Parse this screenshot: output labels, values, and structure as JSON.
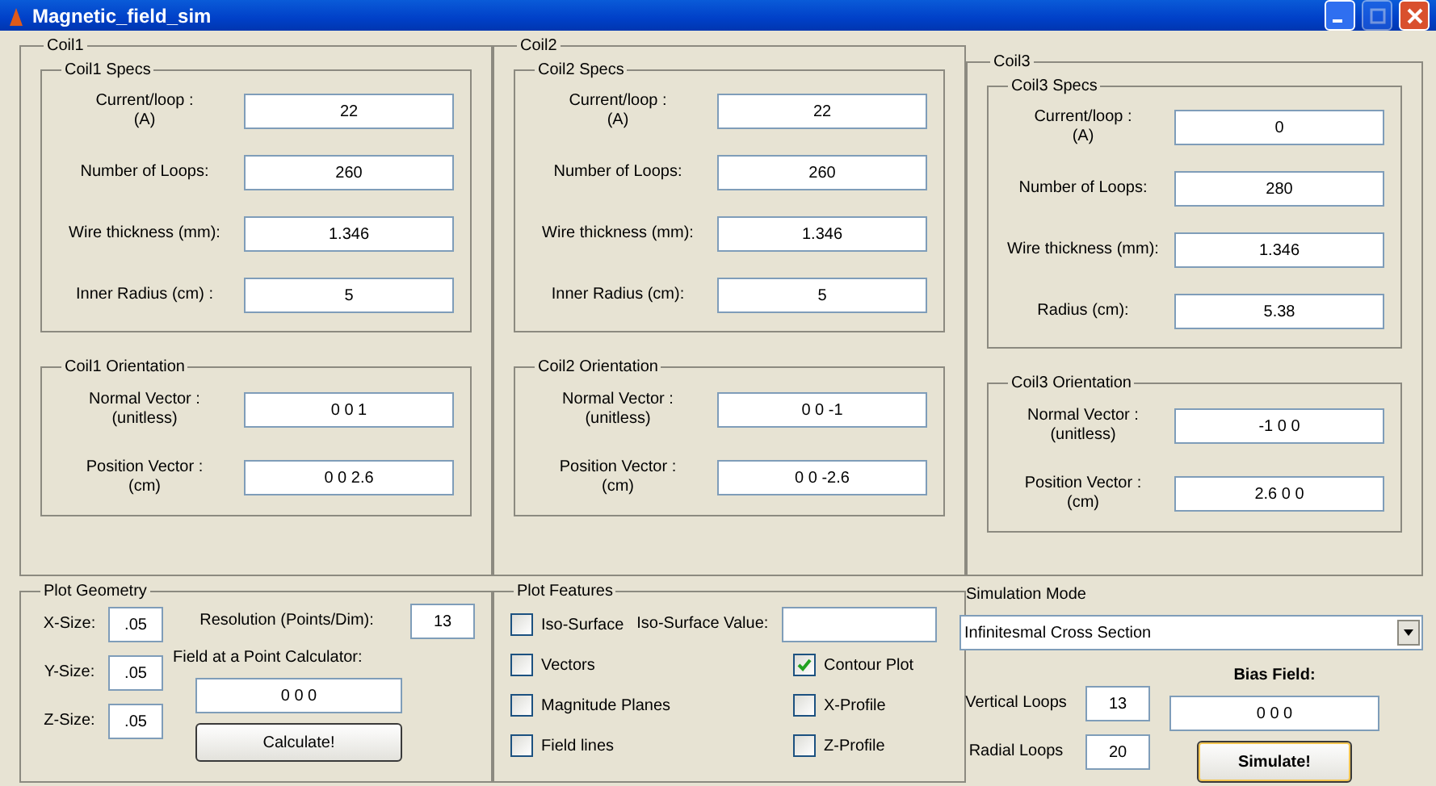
{
  "window": {
    "title": "Magnetic_field_sim",
    "buttons": [
      {
        "kind": "minimize",
        "disabled": false
      },
      {
        "kind": "maximize",
        "disabled": true
      },
      {
        "kind": "close",
        "disabled": false
      }
    ]
  },
  "coils": [
    {
      "title": "Coil1",
      "specs": {
        "title": "Coil1 Specs",
        "fields": [
          {
            "label": "Current/loop :\n(A)",
            "value": "22"
          },
          {
            "label": "Number of Loops:",
            "value": "260"
          },
          {
            "label": "Wire thickness (mm):",
            "value": "1.346"
          },
          {
            "label": "Inner Radius (cm) :",
            "value": "5"
          }
        ]
      },
      "orientation": {
        "title": "Coil1 Orientation",
        "fields": [
          {
            "label": "Normal Vector :\n(unitless)",
            "value": "0 0 1"
          },
          {
            "label": "Position Vector :\n(cm)",
            "value": "0 0 2.6"
          }
        ]
      }
    },
    {
      "title": "Coil2",
      "specs": {
        "title": "Coil2 Specs",
        "fields": [
          {
            "label": "Current/loop :\n(A)",
            "value": "22"
          },
          {
            "label": "Number of Loops:",
            "value": "260"
          },
          {
            "label": "Wire thickness (mm):",
            "value": "1.346"
          },
          {
            "label": "Inner Radius (cm):",
            "value": "5"
          }
        ]
      },
      "orientation": {
        "title": "Coil2 Orientation",
        "fields": [
          {
            "label": "Normal Vector :\n(unitless)",
            "value": "0 0 -1"
          },
          {
            "label": "Position Vector :\n(cm)",
            "value": "0 0 -2.6"
          }
        ]
      }
    },
    {
      "title": "Coil3",
      "specs": {
        "title": "Coil3 Specs",
        "fields": [
          {
            "label": "Current/loop :\n(A)",
            "value": "0"
          },
          {
            "label": "Number of Loops:",
            "value": "280"
          },
          {
            "label": "Wire thickness (mm):",
            "value": "1.346"
          },
          {
            "label": "Radius (cm):",
            "value": "5.38"
          }
        ]
      },
      "orientation": {
        "title": "Coil3 Orientation",
        "fields": [
          {
            "label": "Normal Vector :\n(unitless)",
            "value": "-1 0 0"
          },
          {
            "label": "Position Vector :\n(cm)",
            "value": "2.6 0 0"
          }
        ]
      }
    }
  ],
  "plot_geometry": {
    "title": "Plot Geometry",
    "sizes": [
      {
        "label": "X-Size:",
        "value": ".05"
      },
      {
        "label": "Y-Size:",
        "value": ".05"
      },
      {
        "label": "Z-Size:",
        "value": ".05"
      }
    ],
    "resolution": {
      "label": "Resolution (Points/Dim):",
      "value": "13"
    },
    "calculator": {
      "label": "Field at a Point Calculator:",
      "value": "0 0 0"
    },
    "button": "Calculate!"
  },
  "plot_features": {
    "title": "Plot Features",
    "iso_value": {
      "label": "Iso-Surface Value:"
    },
    "left_options": [
      {
        "label": "Iso-Surface",
        "checked": false
      },
      {
        "label": "Vectors",
        "checked": false
      },
      {
        "label": "Magnitude Planes",
        "checked": false
      },
      {
        "label": "Field lines",
        "checked": false
      }
    ],
    "right_options": [
      {
        "label": "Contour Plot",
        "checked": true
      },
      {
        "label": "X-Profile",
        "checked": false
      },
      {
        "label": "Z-Profile",
        "checked": false
      }
    ]
  },
  "simulation": {
    "mode_label": "Simulation Mode",
    "mode_value": "Infinitesmal Cross Section",
    "vertical_loops": {
      "label": "Vertical Loops",
      "value": "13"
    },
    "radial_loops": {
      "label": "Radial Loops",
      "value": "20"
    },
    "bias_field": {
      "label": "Bias Field:",
      "value": "0 0 0"
    },
    "button": "Simulate!"
  }
}
